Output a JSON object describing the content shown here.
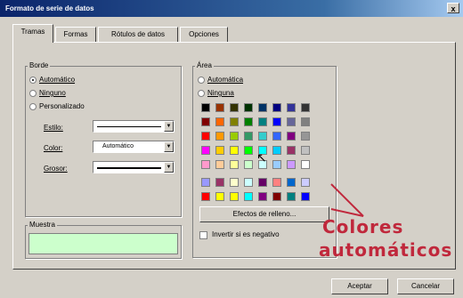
{
  "window": {
    "title": "Formato de serie de datos",
    "close_glyph": "x"
  },
  "tabs": [
    {
      "label": "Tramas",
      "active": true
    },
    {
      "label": "Formas",
      "active": false
    },
    {
      "label": "Rótulos de datos",
      "active": false
    },
    {
      "label": "Opciones",
      "active": false
    }
  ],
  "borde": {
    "title": "Borde",
    "options": [
      "Automático",
      "Ninguno",
      "Personalizado"
    ],
    "selected": "Automático",
    "estilo_label": "Estilo:",
    "color_label": "Color:",
    "color_value": "Automático",
    "grosor_label": "Grosor:"
  },
  "muestra": {
    "title": "Muestra",
    "preview_color": "#ccffcc"
  },
  "area": {
    "title": "Área",
    "options": [
      "Automática",
      "Ninguna"
    ],
    "fill_effects_button": "Efectos de relleno...",
    "invert_label": "Invertir si es negativo",
    "palette_main": [
      [
        "#000000",
        "#993300",
        "#333300",
        "#003300",
        "#003366",
        "#000080",
        "#333399",
        "#333333"
      ],
      [
        "#800000",
        "#ff6600",
        "#808000",
        "#008000",
        "#008080",
        "#0000ff",
        "#666699",
        "#808080"
      ],
      [
        "#ff0000",
        "#ff9900",
        "#99cc00",
        "#339966",
        "#33cccc",
        "#3366ff",
        "#800080",
        "#969696"
      ],
      [
        "#ff00ff",
        "#ffcc00",
        "#ffff00",
        "#00ff00",
        "#00ffff",
        "#00ccff",
        "#993366",
        "#c0c0c0"
      ],
      [
        "#ff99cc",
        "#ffcc99",
        "#ffff99",
        "#ccffcc",
        "#ccffff",
        "#99ccff",
        "#cc99ff",
        "#ffffff"
      ]
    ],
    "palette_chart": [
      [
        "#9999ff",
        "#993366",
        "#ffffcc",
        "#ccffff",
        "#660066",
        "#ff8080",
        "#0066cc",
        "#ccccff"
      ],
      [
        "#ff0000",
        "#ffff00",
        "#ffff00",
        "#00ffff",
        "#800080",
        "#800000",
        "#008080",
        "#0000ff"
      ]
    ]
  },
  "annotation": {
    "line1": "Colores",
    "line2": "automáticos",
    "color": "#c0283c"
  },
  "buttons": {
    "ok": "Aceptar",
    "cancel": "Cancelar"
  }
}
